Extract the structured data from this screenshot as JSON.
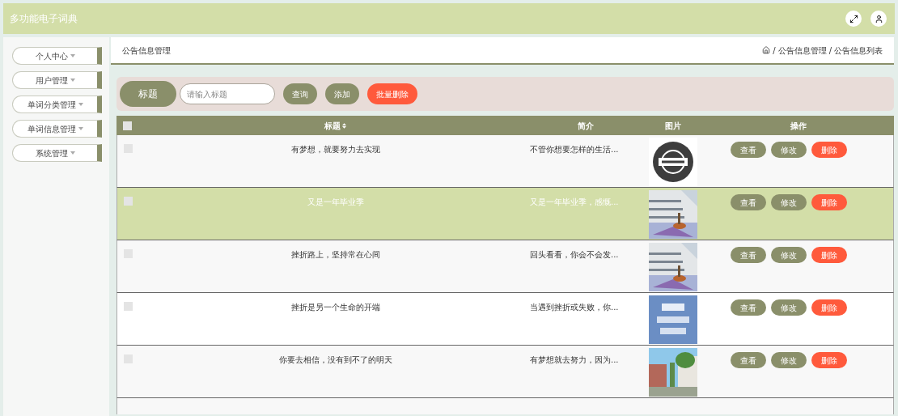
{
  "app": {
    "title": "多功能电子词典"
  },
  "sidebar": {
    "items": [
      {
        "label": "个人中心"
      },
      {
        "label": "用户管理"
      },
      {
        "label": "单词分类管理"
      },
      {
        "label": "单词信息管理"
      },
      {
        "label": "系统管理"
      }
    ]
  },
  "page": {
    "title": "公告信息管理",
    "breadcrumb_separator": "/",
    "breadcrumb": [
      "公告信息管理",
      "公告信息列表"
    ]
  },
  "search": {
    "label": "标题",
    "placeholder": "请输入标题",
    "buttons": [
      {
        "label": "查询",
        "kind": "normal"
      },
      {
        "label": "添加",
        "kind": "normal"
      },
      {
        "label": "批量删除",
        "kind": "danger"
      }
    ]
  },
  "table": {
    "header_checked": false,
    "columns": [
      "标题",
      "简介",
      "图片",
      "操作"
    ],
    "rows": [
      {
        "title": "有梦想，就要努力去实现",
        "intro": "不管你想要怎样的生活...",
        "checked": false,
        "selected": false,
        "actions": [
          {
            "label": "查看",
            "kind": "normal"
          },
          {
            "label": "修改",
            "kind": "normal"
          },
          {
            "label": "删除",
            "kind": "danger"
          }
        ]
      },
      {
        "title": "又是一年毕业季",
        "intro": "又是一年毕业季，感慨...",
        "checked": false,
        "selected": true,
        "actions": [
          {
            "label": "查看",
            "kind": "normal"
          },
          {
            "label": "修改",
            "kind": "normal"
          },
          {
            "label": "删除",
            "kind": "danger"
          }
        ]
      },
      {
        "title": "挫折路上，坚持常在心间",
        "intro": "回头看看，你会不会发...",
        "checked": false,
        "selected": false,
        "actions": [
          {
            "label": "查看",
            "kind": "normal"
          },
          {
            "label": "修改",
            "kind": "normal"
          },
          {
            "label": "删除",
            "kind": "danger"
          }
        ]
      },
      {
        "title": "挫折是另一个生命的开端",
        "intro": "当遇到挫折或失败，你...",
        "checked": false,
        "selected": false,
        "actions": [
          {
            "label": "查看",
            "kind": "normal"
          },
          {
            "label": "修改",
            "kind": "normal"
          },
          {
            "label": "删除",
            "kind": "danger"
          }
        ]
      },
      {
        "title": "你要去相信，没有到不了的明天",
        "intro": "有梦想就去努力，因为...",
        "checked": false,
        "selected": false,
        "actions": [
          {
            "label": "查看",
            "kind": "normal"
          },
          {
            "label": "修改",
            "kind": "normal"
          },
          {
            "label": "删除",
            "kind": "danger"
          }
        ]
      }
    ]
  }
}
